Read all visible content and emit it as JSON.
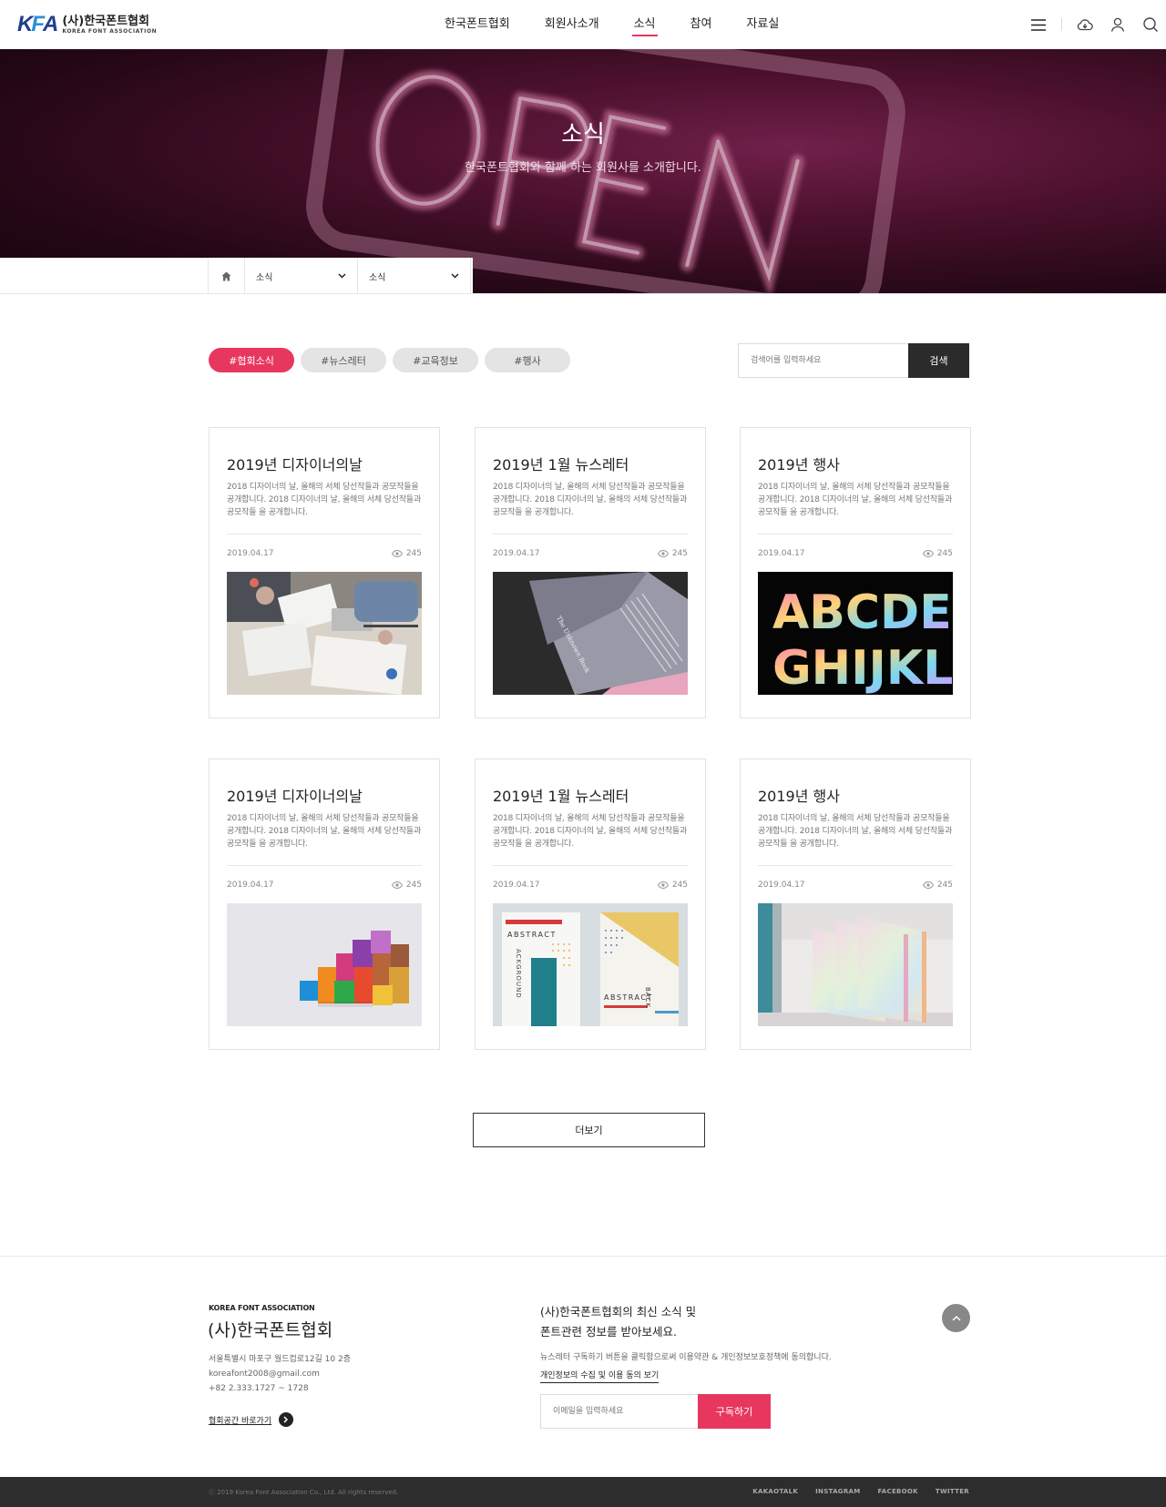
{
  "header": {
    "logo_mark_a": "K",
    "logo_mark_b": "F",
    "logo_mark_c": "A",
    "logo_ko": "(사)한국폰트협회",
    "logo_en": "KOREA FONT ASSOCIATION",
    "nav": [
      {
        "label": "한국폰트협회"
      },
      {
        "label": "회원사소개"
      },
      {
        "label": "소식",
        "active": true
      },
      {
        "label": "참여"
      },
      {
        "label": "자료실"
      }
    ],
    "icons": [
      "menu-icon",
      "download-icon",
      "user-icon",
      "search-icon"
    ]
  },
  "hero": {
    "title": "소식",
    "subtitle": "한국폰트협회와 함께 하는 회원사를 소개합니다."
  },
  "breadcrumb": {
    "level1": "소식",
    "level2": "소식"
  },
  "tags": [
    "#협회소식",
    "#뉴스레터",
    "#교육정보",
    "#행사"
  ],
  "search": {
    "placeholder": "검색어를 입력하세요",
    "button": "검색"
  },
  "cards": [
    {
      "title": "2019년 디자이너의날",
      "desc": "2018 디자이너의 날, 올해의 서체 당선작들과 공모작들을 공개합니다. 2018 디자이너의 날, 올해의 서체 당선작들과 공모작들 을 공개합니다.",
      "date": "2019.04.17",
      "views": "245",
      "image": "meeting-photo"
    },
    {
      "title": "2019년 1월 뉴스레터",
      "desc": "2018 디자이너의 날, 올해의 서체 당선작들과 공모작들을 공개합니다. 2018 디자이너의 날, 올해의 서체 당선작들과 공모작들 을 공개합니다.",
      "date": "2019.04.17",
      "views": "245",
      "image": "book-photo",
      "image_text": "The Unknown Book"
    },
    {
      "title": "2019년 행사",
      "desc": "2018 디자이너의 날, 올해의 서체 당선작들과 공모작들을 공개합니다. 2018 디자이너의 날, 올해의 서체 당선작들과 공모작들 을 공개합니다.",
      "date": "2019.04.17",
      "views": "245",
      "image": "alphabet-photo",
      "image_text": [
        "ABCDE",
        "GHIJKL"
      ]
    },
    {
      "title": "2019년 디자이너의날",
      "desc": "2018 디자이너의 날, 올해의 서체 당선작들과 공모작들을 공개합니다. 2018 디자이너의 날, 올해의 서체 당선작들과 공모작들 을 공개합니다.",
      "date": "2019.04.17",
      "views": "245",
      "image": "blocks-photo"
    },
    {
      "title": "2019년 1월 뉴스레터",
      "desc": "2018 디자이너의 날, 올해의 서체 당선작들과 공모작들을 공개합니다. 2018 디자이너의 날, 올해의 서체 당선작들과 공모작들 을 공개합니다.",
      "date": "2019.04.17",
      "views": "245",
      "image": "abstract-posters",
      "image_text": [
        "ABSTRACT",
        "ACKGROUND",
        "ABSTRACT",
        "BACK"
      ]
    },
    {
      "title": "2019년 행사",
      "desc": "2018 디자이너의 날, 올해의 서체 당선작들과 공모작들을 공개합니다. 2018 디자이너의 날, 올해의 서체 당선작들과 공모작들 을 공개합니다.",
      "date": "2019.04.17",
      "views": "245",
      "image": "glass-panels-photo"
    }
  ],
  "more_button": "더보기",
  "footer": {
    "org_en": "KOREA FONT ASSOCIATION",
    "org_ko": "(사)한국폰트협회",
    "address": "서울특별시 마포구 월드컵로12길 10 2층",
    "email": "koreafont2008@gmail.com",
    "phone": "+82 2.333.1727 ~ 1728",
    "space_link": "협회공간 바로가기",
    "newsletter_line1": "(사)한국폰트협회의 최신 소식 및",
    "newsletter_line2": "폰트관련 정보를 받아보세요.",
    "notice": "뉴스레터 구독하기 버튼을 클릭함으로써 이용약관 & 개인정보보호정책에 동의합니다.",
    "agree_link": "개인정보의 수집 및 이용 동의 보기",
    "email_placeholder": "이메일을 입력하세요",
    "subscribe": "구독하기",
    "copyright": "ⓒ  2019 Korea Font Association Co., Ltd. All rights reserved.",
    "sns": [
      "KAKAOTALK",
      "INSTAGRAM",
      "FACEBOOK",
      "TWITTER"
    ]
  },
  "colors": {
    "accent": "#e8375f",
    "dark": "#2b2b2b",
    "logo_blue": "#1f3f8f"
  }
}
